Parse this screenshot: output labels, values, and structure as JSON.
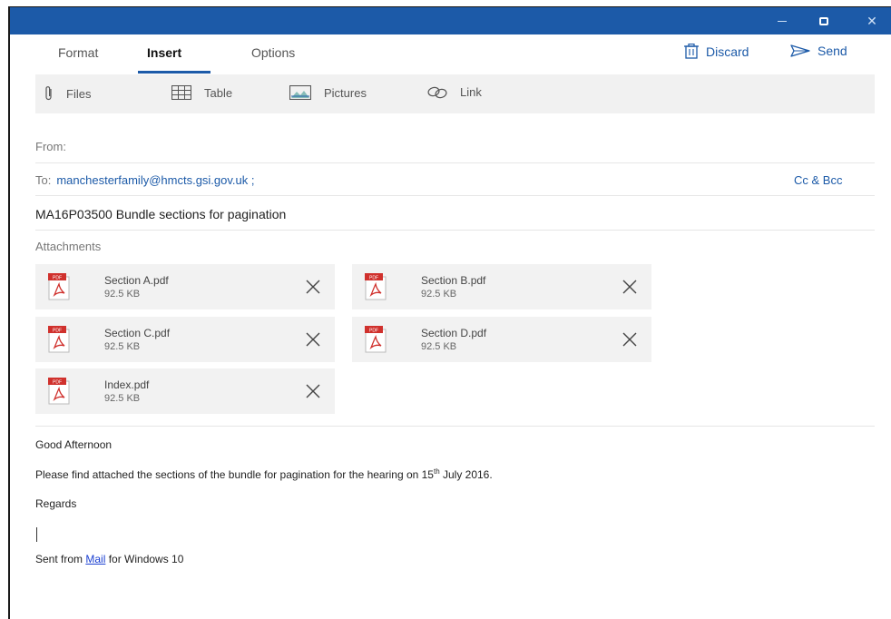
{
  "window": {
    "close_glyph": "✕"
  },
  "tabs": [
    {
      "label": "Format",
      "active": false
    },
    {
      "label": "Insert",
      "active": true
    },
    {
      "label": "Options",
      "active": false
    }
  ],
  "actions": {
    "discard": "Discard",
    "send": "Send"
  },
  "toolbar": {
    "files": "Files",
    "table": "Table",
    "pictures": "Pictures",
    "link": "Link"
  },
  "header": {
    "from_label": "From:",
    "to_label": "To:",
    "to_address": "manchesterfamily@hmcts.gsi.gov.uk ;",
    "cc_bcc": "Cc & Bcc",
    "subject": "MA16P03500 Bundle sections for pagination",
    "attachments_label": "Attachments"
  },
  "attachments": [
    {
      "name": "Section A.pdf",
      "size": "92.5 KB"
    },
    {
      "name": "Section B.pdf",
      "size": "92.5 KB"
    },
    {
      "name": "Section C.pdf",
      "size": "92.5 KB"
    },
    {
      "name": "Section D.pdf",
      "size": "92.5 KB"
    },
    {
      "name": "Index.pdf",
      "size": "92.5 KB"
    }
  ],
  "pdf_badge": "PDF",
  "body": {
    "greeting": "Good Afternoon",
    "line1_pre": "Please find attached the sections of the bundle for pagination for the hearing on 15",
    "line1_sup": "th",
    "line1_post": " July 2016.",
    "regards": "Regards",
    "sig_pre": "Sent from ",
    "sig_link": "Mail",
    "sig_post": " for Windows 10"
  },
  "colors": {
    "accent": "#1c5aa8",
    "pdf_red": "#d0312d",
    "link": "#1a3fd1"
  }
}
